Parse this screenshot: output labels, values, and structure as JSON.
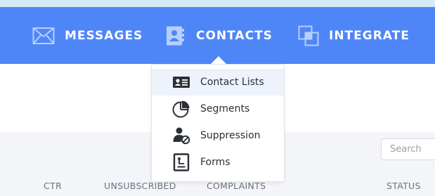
{
  "nav": {
    "items": [
      {
        "label": "MESSAGES",
        "icon": "envelope-icon"
      },
      {
        "label": "CONTACTS",
        "icon": "address-book-icon"
      },
      {
        "label": "INTEGRATE",
        "icon": "integrate-icon"
      }
    ],
    "active": "CONTACTS"
  },
  "dropdown": {
    "items": [
      {
        "label": "Contact Lists",
        "icon": "contact-card-icon",
        "highlighted": true
      },
      {
        "label": "Segments",
        "icon": "pie-chart-icon",
        "highlighted": false
      },
      {
        "label": "Suppression",
        "icon": "user-blocked-icon",
        "highlighted": false
      },
      {
        "label": "Forms",
        "icon": "form-document-icon",
        "highlighted": false
      }
    ]
  },
  "search": {
    "placeholder": "Search",
    "value": ""
  },
  "table": {
    "columns": [
      "CTR",
      "UNSUBSCRIBED",
      "COMPLAINTS",
      "STATUS"
    ]
  },
  "colors": {
    "nav_background": "#4f86f7",
    "top_strip": "#d3ecf7",
    "nav_text": "#ffffff",
    "content_gray": "#f4f5f8",
    "menu_highlight": "#eef2fa"
  }
}
